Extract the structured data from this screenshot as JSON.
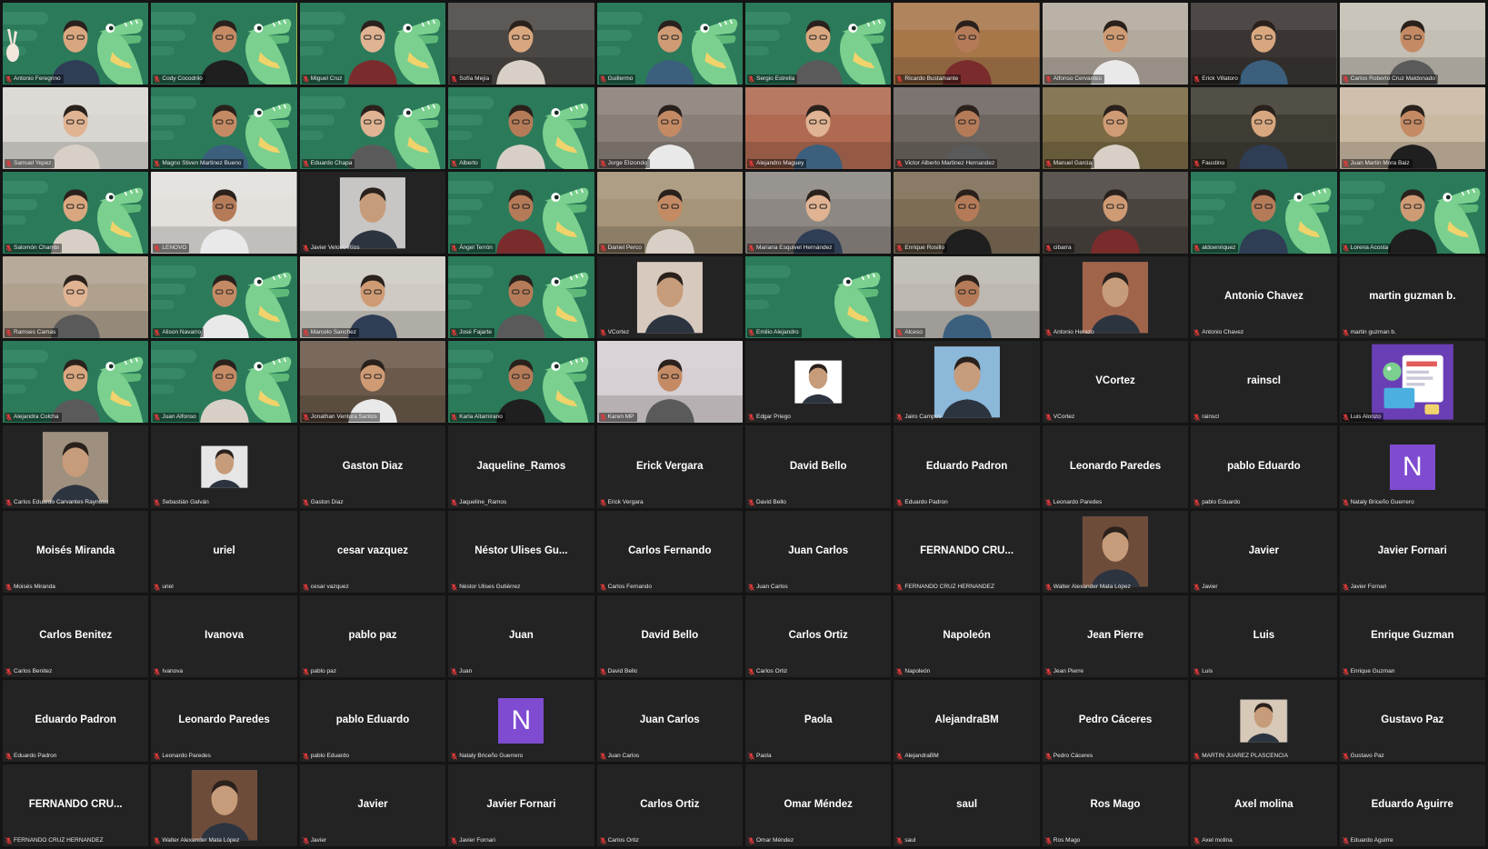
{
  "app": {
    "view": "gallery"
  },
  "colors": {
    "croc_bg": "#2b7a5a",
    "croc_body": "#7bd08f",
    "tile_dark": "#232323",
    "active_border": "#e5e14a",
    "mic_muted": "#e23b3b",
    "letter_avatar": "#7e4bd1"
  },
  "participants": [
    {
      "label": "Antonio Feregrino",
      "kind": "croc",
      "peace": true
    },
    {
      "label": "Cody Cocodrilo",
      "kind": "croc",
      "active": true
    },
    {
      "label": "Miguel Cruz",
      "kind": "croc"
    },
    {
      "label": "Sofía Mejía",
      "kind": "cam",
      "tone": "#4b4744"
    },
    {
      "label": "Guillermo",
      "kind": "croc"
    },
    {
      "label": "Sergio Estrella",
      "kind": "croc"
    },
    {
      "label": "Ricardo Bustamante",
      "kind": "cam",
      "tone": "#a7774a"
    },
    {
      "label": "Alfonso Cervantes",
      "kind": "cam",
      "tone": "#b3aa9e"
    },
    {
      "label": "Erick Villatoro",
      "kind": "cam",
      "tone": "#3a3533"
    },
    {
      "label": "Carlos Roberto Cruz Maldonado",
      "kind": "cam",
      "tone": "#c4bfb4"
    },
    {
      "label": "Samuel Yepez",
      "kind": "cam",
      "tone": "#d9d6d1"
    },
    {
      "label": "Magno Stiven Martinez Bueno",
      "kind": "croc"
    },
    {
      "label": "Eduardo Chapa",
      "kind": "croc"
    },
    {
      "label": "Alberto",
      "kind": "croc"
    },
    {
      "label": "Jorge Elizondo",
      "kind": "cam",
      "tone": "#8a7f78"
    },
    {
      "label": "Alejandro Maguey",
      "kind": "cam",
      "tone": "#b06a52"
    },
    {
      "label": "Victor Alberto Martinez Hernandez",
      "kind": "cam",
      "tone": "#6d6560"
    },
    {
      "label": "Manuel Garcia",
      "kind": "cam",
      "tone": "#7a6a45"
    },
    {
      "label": "Faustino",
      "kind": "cam",
      "tone": "#3f3c33"
    },
    {
      "label": "Juan Martin Mora Baiz",
      "kind": "cam",
      "tone": "#c9b9a3"
    },
    {
      "label": "Salomón Chambi",
      "kind": "croc"
    },
    {
      "label": "LENOVO",
      "kind": "cam",
      "tone": "#e3e0dc"
    },
    {
      "label": "Javier Veloso Ríos",
      "kind": "avatar",
      "tone": "#c8c6c4"
    },
    {
      "label": "Ángel Terrón",
      "kind": "croc"
    },
    {
      "label": "Daniel Perco",
      "kind": "cam",
      "tone": "#a59478"
    },
    {
      "label": "Mariana Esquivel Hernández",
      "kind": "cam",
      "tone": "#8d8883"
    },
    {
      "label": "Enrique Rosillo",
      "kind": "cam",
      "tone": "#7d6d55"
    },
    {
      "label": "cibarra",
      "kind": "cam",
      "tone": "#4a443f"
    },
    {
      "label": "aldoenriquez",
      "kind": "croc"
    },
    {
      "label": "Lorena Acosta",
      "kind": "croc"
    },
    {
      "label": "Ramses Camas",
      "kind": "cam",
      "tone": "#b0a18f"
    },
    {
      "label": "Alison Navarro",
      "kind": "croc"
    },
    {
      "label": "Marcelo Sanchez",
      "kind": "cam",
      "tone": "#cfcac3"
    },
    {
      "label": "José Fajarte",
      "kind": "croc"
    },
    {
      "label": "VCortez",
      "kind": "avatar",
      "tone": "#d8c9be"
    },
    {
      "label": "Emilio Alejandro",
      "kind": "croc",
      "nobody": true
    },
    {
      "label": "Alceso",
      "kind": "cam",
      "tone": "#bdb8b2"
    },
    {
      "label": "Antonio Herazo",
      "kind": "avatar",
      "tone": "#a0644a"
    },
    {
      "label": "Antonio Chavez",
      "kind": "name",
      "display": "Antonio Chavez"
    },
    {
      "label": "martin guzman b.",
      "kind": "name",
      "display": "martin guzman b."
    },
    {
      "label": "Alejandra Colcha",
      "kind": "croc"
    },
    {
      "label": "Juan Alfonso",
      "kind": "croc"
    },
    {
      "label": "Jonathan Ventura Santos",
      "kind": "cam",
      "tone": "#6b5a4c"
    },
    {
      "label": "Karla Altamirano",
      "kind": "croc"
    },
    {
      "label": "Karen MP",
      "kind": "cam",
      "tone": "#d6cfd3"
    },
    {
      "label": "Edgar Priego",
      "kind": "avatar",
      "tone": "#ffffff",
      "small": true
    },
    {
      "label": "Jairo Campos",
      "kind": "avatar",
      "tone": "#8cb8da"
    },
    {
      "label": "VCortez",
      "kind": "name",
      "display": "VCortez"
    },
    {
      "label": "rainscl",
      "kind": "name",
      "display": "rainscl"
    },
    {
      "label": "Luis Alonzo",
      "kind": "illus"
    },
    {
      "label": "Carlos Eduardo Carvantes Raynoso",
      "kind": "avatar",
      "tone": "#9e8f7e"
    },
    {
      "label": "Sebastián Galván",
      "kind": "avatar",
      "tone": "#e6e6e6",
      "small": true
    },
    {
      "label": "Gaston Diaz",
      "kind": "name",
      "display": "Gaston Diaz"
    },
    {
      "label": "Jaqueline_Ramos",
      "kind": "name",
      "display": "Jaqueline_Ramos"
    },
    {
      "label": "Erick Vergara",
      "kind": "name",
      "display": "Erick Vergara"
    },
    {
      "label": "David Bello",
      "kind": "name",
      "display": "David Bello"
    },
    {
      "label": "Eduardo Padron",
      "kind": "name",
      "display": "Eduardo Padron"
    },
    {
      "label": "Leonardo Paredes",
      "kind": "name",
      "display": "Leonardo Paredes"
    },
    {
      "label": "pablo Eduardo",
      "kind": "name",
      "display": "pablo Eduardo"
    },
    {
      "label": "Nataly Briceño Guerrero",
      "kind": "letter",
      "letter": "N"
    },
    {
      "label": "Moisés Miranda",
      "kind": "name",
      "display": "Moisés Miranda"
    },
    {
      "label": "uriel",
      "kind": "name",
      "display": "uriel"
    },
    {
      "label": "cesar vazquez",
      "kind": "name",
      "display": "cesar vazquez"
    },
    {
      "label": "Néstor Ulises Gutiérrez",
      "kind": "name",
      "display": "Néstor Ulises Gu..."
    },
    {
      "label": "Carlos Fernando",
      "kind": "name",
      "display": "Carlos Fernando"
    },
    {
      "label": "Juan Carlos",
      "kind": "name",
      "display": "Juan Carlos"
    },
    {
      "label": "FERNANDO CRUZ HERNANDEZ",
      "kind": "name",
      "display": "FERNANDO CRU..."
    },
    {
      "label": "Walter Alexander Mata López",
      "kind": "avatar",
      "tone": "#6e4c3a"
    },
    {
      "label": "Javier",
      "kind": "name",
      "display": "Javier"
    },
    {
      "label": "Javier Fornari",
      "kind": "name",
      "display": "Javier Fornari"
    },
    {
      "label": "Carlos Benitez",
      "kind": "name",
      "display": "Carlos Benitez"
    },
    {
      "label": "Ivanova",
      "kind": "name",
      "display": "Ivanova"
    },
    {
      "label": "pablo paz",
      "kind": "name",
      "display": "pablo paz"
    },
    {
      "label": "Juan",
      "kind": "name",
      "display": "Juan"
    },
    {
      "label": "David Bello",
      "kind": "name",
      "display": "David Bello"
    },
    {
      "label": "Carlos Ortiz",
      "kind": "name",
      "display": "Carlos Ortiz"
    },
    {
      "label": "Napoleón",
      "kind": "name",
      "display": "Napoleón"
    },
    {
      "label": "Jean Pierre",
      "kind": "name",
      "display": "Jean Pierre"
    },
    {
      "label": "Luis",
      "kind": "name",
      "display": "Luis"
    },
    {
      "label": "Enrique Guzman",
      "kind": "name",
      "display": "Enrique Guzman"
    },
    {
      "label": "Eduardo Padron",
      "kind": "name",
      "display": "Eduardo Padron"
    },
    {
      "label": "Leonardo Paredes",
      "kind": "name",
      "display": "Leonardo Paredes"
    },
    {
      "label": "pablo Eduardo",
      "kind": "name",
      "display": "pablo Eduardo"
    },
    {
      "label": "Nataly Briceño Guerrero",
      "kind": "letter",
      "letter": "N"
    },
    {
      "label": "Juan Carlos",
      "kind": "name",
      "display": "Juan Carlos"
    },
    {
      "label": "Paola",
      "kind": "name",
      "display": "Paola"
    },
    {
      "label": "AlejandraBM",
      "kind": "name",
      "display": "AlejandraBM"
    },
    {
      "label": "Pedro Cáceres",
      "kind": "name",
      "display": "Pedro Cáceres"
    },
    {
      "label": "MARTIN JUAREZ PLASCENCIA",
      "kind": "avatar",
      "tone": "#d7c8b7",
      "small": true
    },
    {
      "label": "Gustavo Paz",
      "kind": "name",
      "display": "Gustavo Paz"
    },
    {
      "label": "FERNANDO CRUZ HERNANDEZ",
      "kind": "name",
      "display": "FERNANDO CRU..."
    },
    {
      "label": "Walter Alexander Mata López",
      "kind": "avatar",
      "tone": "#6e4c3a"
    },
    {
      "label": "Javier",
      "kind": "name",
      "display": "Javier"
    },
    {
      "label": "Javier Fornari",
      "kind": "name",
      "display": "Javier Fornari"
    },
    {
      "label": "Carlos Ortiz",
      "kind": "name",
      "display": "Carlos Ortiz"
    },
    {
      "label": "Omar Méndez",
      "kind": "name",
      "display": "Omar Méndez"
    },
    {
      "label": "saul",
      "kind": "name",
      "display": "saul"
    },
    {
      "label": "Ros Mago",
      "kind": "name",
      "display": "Ros Mago"
    },
    {
      "label": "Axel molina",
      "kind": "name",
      "display": "Axel molina"
    },
    {
      "label": "Eduardo Aguirre",
      "kind": "name",
      "display": "Eduardo Aguirre"
    }
  ]
}
